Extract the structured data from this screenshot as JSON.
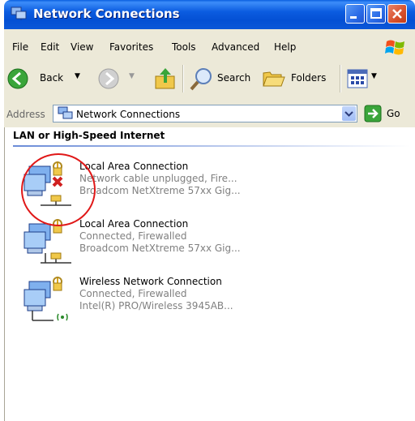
{
  "window": {
    "title": "Network Connections",
    "accent": "#0a5fe0"
  },
  "menubar": {
    "items": [
      "File",
      "Edit",
      "View",
      "Favorites",
      "Tools",
      "Advanced",
      "Help"
    ]
  },
  "toolbar": {
    "back_label": "Back",
    "search_label": "Search",
    "folders_label": "Folders"
  },
  "address": {
    "label": "Address",
    "value": "Network Connections",
    "go_label": "Go"
  },
  "content": {
    "group_title": "LAN or High-Speed Internet",
    "connections": [
      {
        "name": "Local Area Connection",
        "status": "Network cable unplugged, Fire...",
        "device": "Broadcom NetXtreme 57xx Gig...",
        "state": "unplugged"
      },
      {
        "name": "Local Area Connection",
        "status": "Connected, Firewalled",
        "device": "Broadcom NetXtreme 57xx Gig...",
        "state": "connected"
      },
      {
        "name": "Wireless Network Connection",
        "status": "Connected, Firewalled",
        "device": "Intel(R) PRO/Wireless 3945AB...",
        "state": "wireless"
      }
    ],
    "annotation_color": "#e01818"
  }
}
